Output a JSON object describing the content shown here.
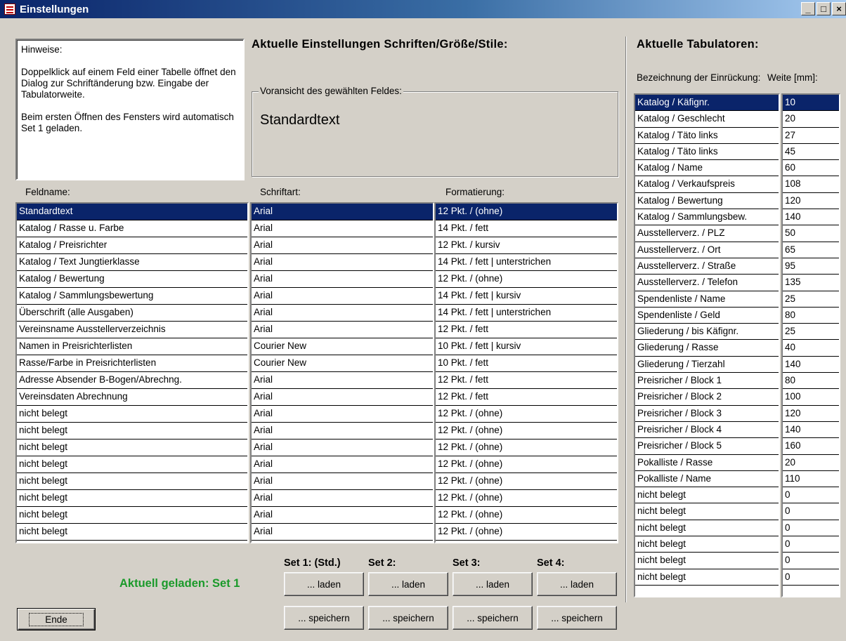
{
  "window": {
    "title": "Einstellungen",
    "controls": [
      "_",
      "□",
      "×"
    ]
  },
  "hint": {
    "heading": "Hinweise:",
    "para1": "Doppelklick auf einem Feld einer Tabelle öffnet den Dialog zur Schriftänderung bzw. Eingabe der Tabulatorweite.",
    "para2": "Beim ersten Öffnen des Fensters wird automatisch Set 1 geladen."
  },
  "fonts_section": {
    "heading": "Aktuelle Einstellungen Schriften/Größe/Stile:",
    "preview_legend": "Voransicht des gewählten Feldes:",
    "preview_text": "Standardtext",
    "columns": {
      "feldname": "Feldname:",
      "schriftart": "Schriftart:",
      "formatierung": "Formatierung:"
    },
    "rows": [
      {
        "feld": "Standardtext",
        "font": "Arial",
        "format": "12 Pkt. /  (ohne)",
        "selected": true
      },
      {
        "feld": "Katalog / Rasse u. Farbe",
        "font": "Arial",
        "format": "14 Pkt. /  fett"
      },
      {
        "feld": "Katalog / Preisrichter",
        "font": "Arial",
        "format": "12 Pkt. /  kursiv"
      },
      {
        "feld": "Katalog / Text Jungtierklasse",
        "font": "Arial",
        "format": "14 Pkt. /  fett | unterstrichen"
      },
      {
        "feld": "Katalog / Bewertung",
        "font": "Arial",
        "format": "12 Pkt. /  (ohne)"
      },
      {
        "feld": "Katalog / Sammlungsbewertung",
        "font": "Arial",
        "format": "14 Pkt. /  fett | kursiv"
      },
      {
        "feld": "Überschrift (alle Ausgaben)",
        "font": "Arial",
        "format": "14 Pkt. /  fett | unterstrichen"
      },
      {
        "feld": "Vereinsname Ausstellerverzeichnis",
        "font": "Arial",
        "format": "12 Pkt. /  fett"
      },
      {
        "feld": "Namen in Preisrichterlisten",
        "font": "Courier New",
        "format": "10 Pkt. /  fett | kursiv"
      },
      {
        "feld": "Rasse/Farbe in Preisrichterlisten",
        "font": "Courier New",
        "format": "10 Pkt. /  fett"
      },
      {
        "feld": "Adresse Absender B-Bogen/Abrechng.",
        "font": "Arial",
        "format": "12 Pkt. /  fett"
      },
      {
        "feld": "Vereinsdaten Abrechnung",
        "font": "Arial",
        "format": "12 Pkt. /  fett"
      },
      {
        "feld": "nicht belegt",
        "font": "Arial",
        "format": "12 Pkt. /  (ohne)"
      },
      {
        "feld": "nicht belegt",
        "font": "Arial",
        "format": "12 Pkt. /  (ohne)"
      },
      {
        "feld": "nicht belegt",
        "font": "Arial",
        "format": "12 Pkt. /  (ohne)"
      },
      {
        "feld": "nicht belegt",
        "font": "Arial",
        "format": "12 Pkt. /  (ohne)"
      },
      {
        "feld": "nicht belegt",
        "font": "Arial",
        "format": "12 Pkt. /  (ohne)"
      },
      {
        "feld": "nicht belegt",
        "font": "Arial",
        "format": "12 Pkt. /  (ohne)"
      },
      {
        "feld": "nicht belegt",
        "font": "Arial",
        "format": "12 Pkt. /  (ohne)"
      },
      {
        "feld": "nicht belegt",
        "font": "Arial",
        "format": "12 Pkt. /  (ohne)"
      }
    ]
  },
  "tabs_section": {
    "heading": "Aktuelle Tabulatoren:",
    "col_label": "Bezeichnung der Einrückung:",
    "col_width": "Weite [mm]:",
    "rows": [
      {
        "name": "Katalog / Käfignr.",
        "width": "10",
        "selected": true
      },
      {
        "name": "Katalog / Geschlecht",
        "width": "20"
      },
      {
        "name": "Katalog / Täto links",
        "width": "27"
      },
      {
        "name": "Katalog / Täto links",
        "width": "45"
      },
      {
        "name": "Katalog / Name",
        "width": "60"
      },
      {
        "name": "Katalog / Verkaufspreis",
        "width": "108"
      },
      {
        "name": "Katalog / Bewertung",
        "width": "120"
      },
      {
        "name": "Katalog / Sammlungsbew.",
        "width": "140"
      },
      {
        "name": "Ausstellerverz. / PLZ",
        "width": "50"
      },
      {
        "name": "Ausstellerverz. / Ort",
        "width": "65"
      },
      {
        "name": "Ausstellerverz. / Straße",
        "width": "95"
      },
      {
        "name": "Ausstellerverz. / Telefon",
        "width": "135"
      },
      {
        "name": "Spendenliste / Name",
        "width": "25"
      },
      {
        "name": "Spendenliste / Geld",
        "width": "80"
      },
      {
        "name": "Gliederung / bis Käfignr.",
        "width": "25"
      },
      {
        "name": "Gliederung / Rasse",
        "width": "40"
      },
      {
        "name": "Gliederung / Tierzahl",
        "width": "140"
      },
      {
        "name": "Preisricher / Block 1",
        "width": "80"
      },
      {
        "name": "Preisricher / Block 2",
        "width": "100"
      },
      {
        "name": "Preisricher / Block 3",
        "width": "120"
      },
      {
        "name": "Preisricher / Block 4",
        "width": "140"
      },
      {
        "name": "Preisricher / Block 5",
        "width": "160"
      },
      {
        "name": "Pokalliste / Rasse",
        "width": "20"
      },
      {
        "name": "Pokalliste / Name",
        "width": "110"
      },
      {
        "name": "nicht belegt",
        "width": "0"
      },
      {
        "name": "nicht belegt",
        "width": "0"
      },
      {
        "name": "nicht belegt",
        "width": "0"
      },
      {
        "name": "nicht belegt",
        "width": "0"
      },
      {
        "name": "nicht belegt",
        "width": "0"
      },
      {
        "name": "nicht belegt",
        "width": "0"
      }
    ]
  },
  "sets": {
    "loaded_label": "Aktuell geladen: Set 1",
    "loaded_color": "#1a9a2a",
    "items": [
      {
        "label": "Set 1: (Std.)",
        "load": "... laden",
        "save": "... speichern"
      },
      {
        "label": "Set 2:",
        "load": "... laden",
        "save": "... speichern"
      },
      {
        "label": "Set 3:",
        "load": "... laden",
        "save": "... speichern"
      },
      {
        "label": "Set 4:",
        "load": "... laden",
        "save": "... speichern"
      }
    ]
  },
  "end_button": "Ende",
  "colors": {
    "selection": "#0a246a",
    "face": "#d4d0c8"
  }
}
